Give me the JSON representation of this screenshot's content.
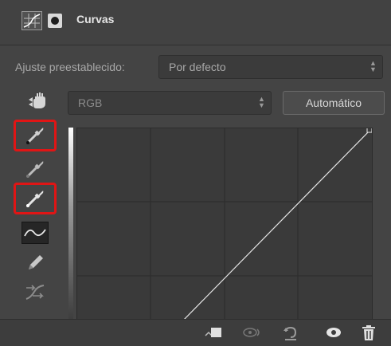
{
  "header": {
    "title": "Curvas",
    "icons": [
      "curves-adjustment-icon",
      "layer-mask-icon"
    ]
  },
  "preset": {
    "label": "Ajuste preestablecido:",
    "value": "Por defecto"
  },
  "channel": {
    "value": "RGB",
    "auto_button_label": "Automático"
  },
  "tools": [
    {
      "name": "sample-black-point-eyedropper",
      "highlighted": true
    },
    {
      "name": "sample-gray-point-eyedropper",
      "highlighted": false
    },
    {
      "name": "sample-white-point-eyedropper",
      "highlighted": true
    },
    {
      "name": "edit-points-curve-tool",
      "active": true
    },
    {
      "name": "draw-pencil-tool"
    },
    {
      "name": "smooth-curve-tool"
    }
  ],
  "bottom_bar": {
    "icons": [
      "clip-to-layer-icon",
      "view-previous-state-icon",
      "reset-icon",
      "visibility-eye-icon",
      "trash-icon"
    ]
  },
  "colors": {
    "panel_bg": "#444444",
    "highlight": "#e01515",
    "curve_line": "#e8e8e8"
  }
}
